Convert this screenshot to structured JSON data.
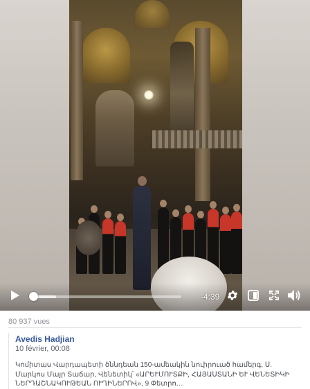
{
  "video": {
    "time_remaining": "-4:39",
    "progress_fraction": 0.02,
    "buffered_fraction": 0.17
  },
  "post": {
    "views": "80 937 vues",
    "author": "Avedis Hadjian",
    "date": "10 février, 00:08",
    "description": "Կոմիտաս Վարդապետի ծննդեան 150-ամեակին նուիրուած համերգ, Ս. Մարկոս Մայր Տաճար, Վենետիկ՝ «ԱՐԵՒՄՈՒՏՔԻ, ՀԱՅԱՍՏԱՆԻ ԵՒ ՎԵՆԵՏԻԿԻ ՆԵՐԴԱՇՆԱԿՈՒԹԵԱՆ ՈՒՂԻՆԵՐՈՎ», 9 Փետրո…"
  },
  "icons": {
    "play": "play-icon",
    "settings": "gear-icon",
    "mini_player": "square-icon",
    "fullscreen": "fullscreen-icon",
    "volume": "volume-icon"
  },
  "colors": {
    "author_link": "#365899",
    "meta_text": "#90949c"
  }
}
